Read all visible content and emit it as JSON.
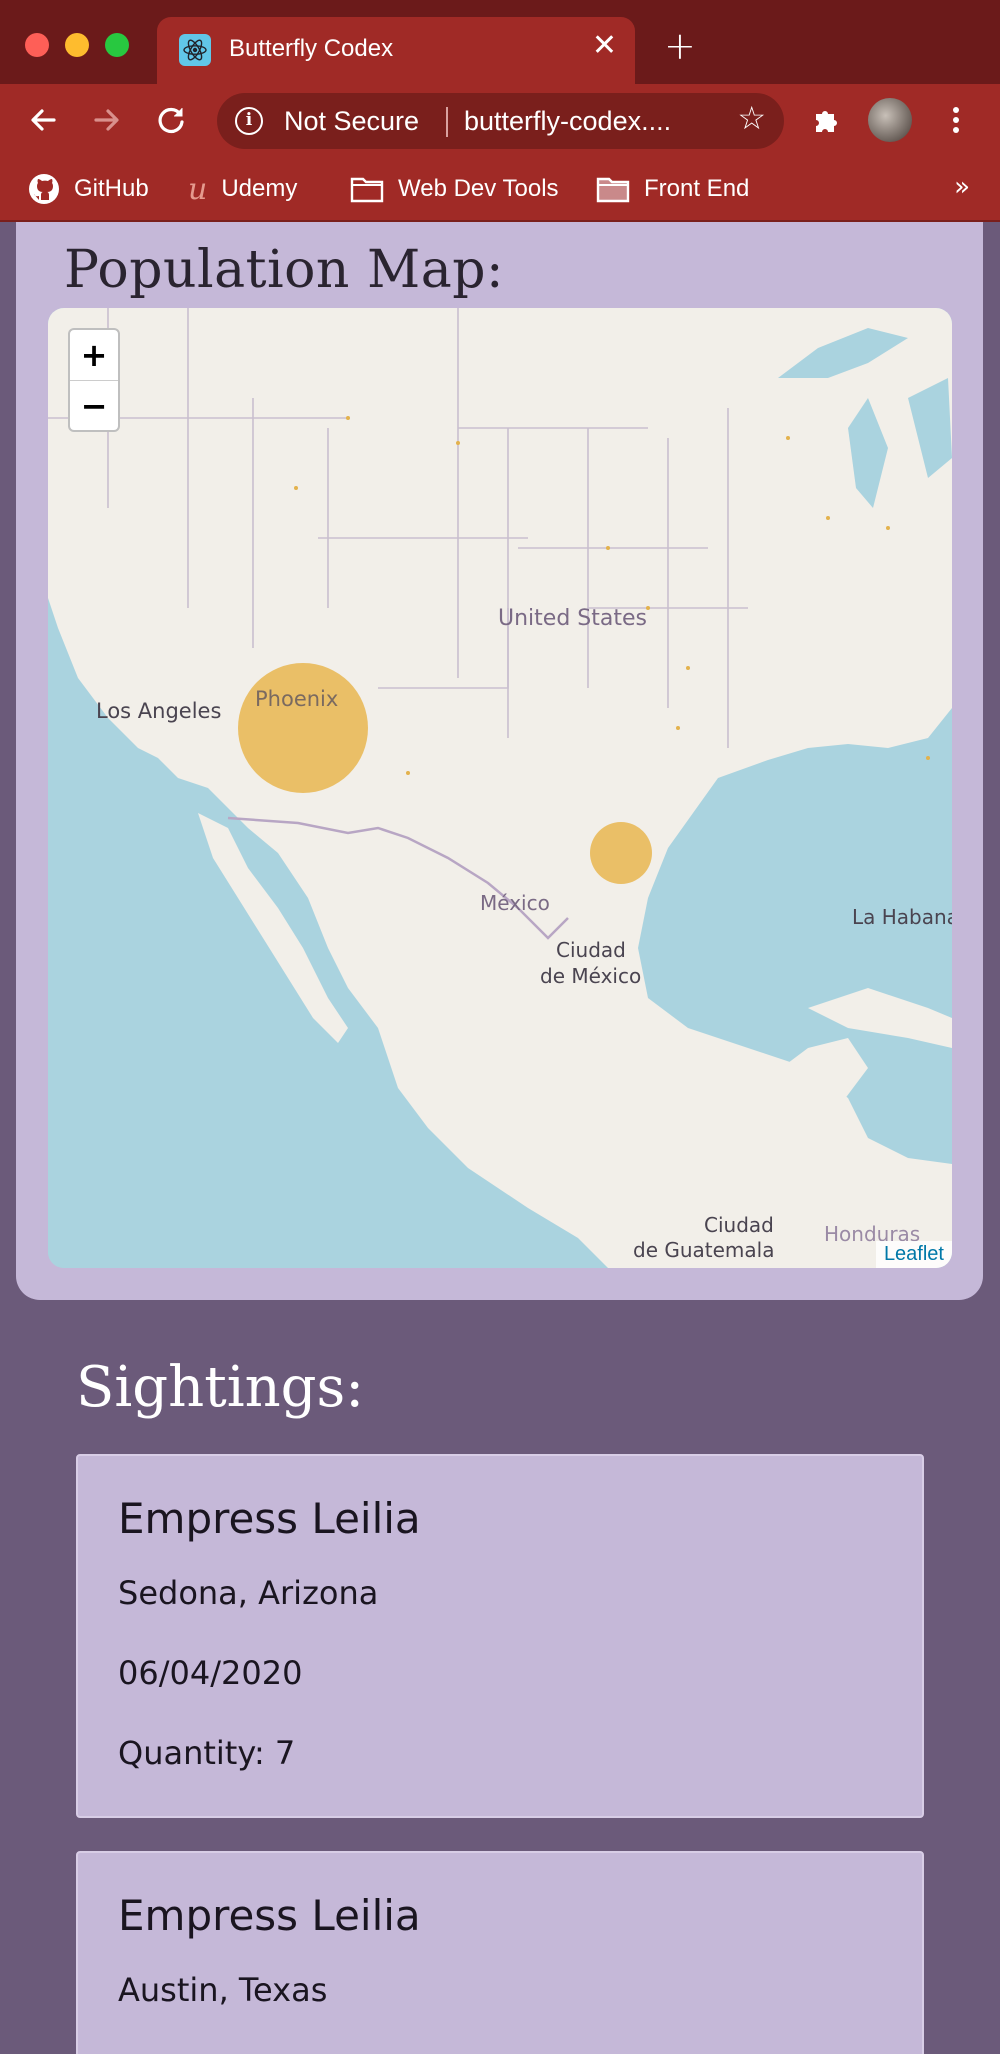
{
  "browser": {
    "tab_title": "Butterfly Codex",
    "address_security": "Not Secure",
    "address_url": "butterfly-codex....",
    "bookmarks": [
      {
        "label": "GitHub",
        "icon": "github-icon"
      },
      {
        "label": "Udemy",
        "icon": "udemy-icon"
      },
      {
        "label": "Web Dev Tools",
        "icon": "folder-icon"
      },
      {
        "label": "Front End",
        "icon": "folder-icon"
      }
    ],
    "bookmarks_more": "»",
    "colors": {
      "frame": "#a02a26",
      "frame_dark": "#6b1a1a"
    }
  },
  "map_section": {
    "heading": "Population Map:",
    "zoom_in": "+",
    "zoom_out": "−",
    "attribution": "Leaflet",
    "labels": {
      "united_states": "United States",
      "los_angeles": "Los Angeles",
      "phoenix": "Phoenix",
      "mexico": "México",
      "ciudad_mexico_1": "Ciudad",
      "ciudad_mexico_2": "de México",
      "la_habana": "La Habana",
      "ciudad_guatemala_1": "Ciudad",
      "ciudad_guatemala_2": "de Guatemala",
      "honduras": "Honduras"
    },
    "population_markers": [
      {
        "place": "Sedona, Arizona",
        "quantity": 7
      },
      {
        "place": "Austin, Texas"
      }
    ],
    "colors": {
      "marker": "#e8b44a",
      "water": "#aad3df",
      "land": "#f2efe9"
    }
  },
  "sightings_section": {
    "heading": "Sightings:",
    "items": [
      {
        "name": "Empress Leilia",
        "place": "Sedona, Arizona",
        "date": "06/04/2020",
        "quantity": "Quantity: 7"
      },
      {
        "name": "Empress Leilia",
        "place": "Austin, Texas"
      }
    ]
  }
}
